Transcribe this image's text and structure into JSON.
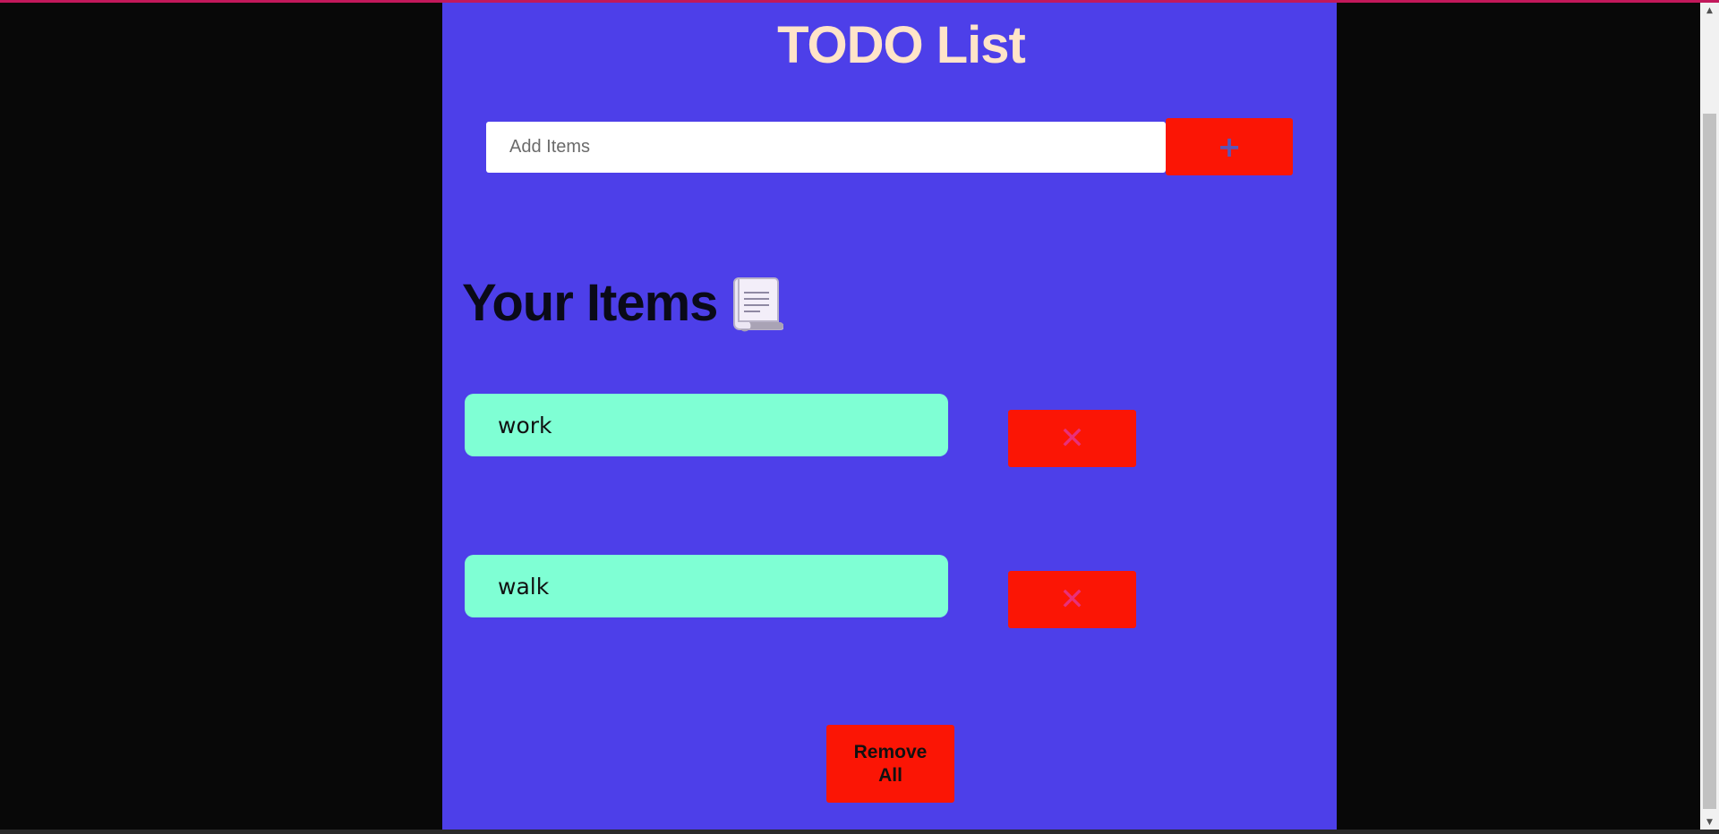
{
  "app": {
    "title": "TODO List"
  },
  "add_form": {
    "placeholder": "Add Items",
    "value": "",
    "add_icon": "+"
  },
  "items_section": {
    "heading": "Your Items",
    "heading_icon": "scroll-icon"
  },
  "items": [
    {
      "text": "work",
      "delete_icon": "✕"
    },
    {
      "text": "walk",
      "delete_icon": "✕"
    }
  ],
  "actions": {
    "remove_all_label": "Remove All"
  },
  "colors": {
    "page_background": "#080808",
    "panel_background": "#4d3fe9",
    "title_color": "#ffe4c9",
    "button_red": "#fb1505",
    "item_background": "#7fffd4",
    "delete_icon_color": "#e8307a",
    "top_accent": "#c2185b"
  }
}
